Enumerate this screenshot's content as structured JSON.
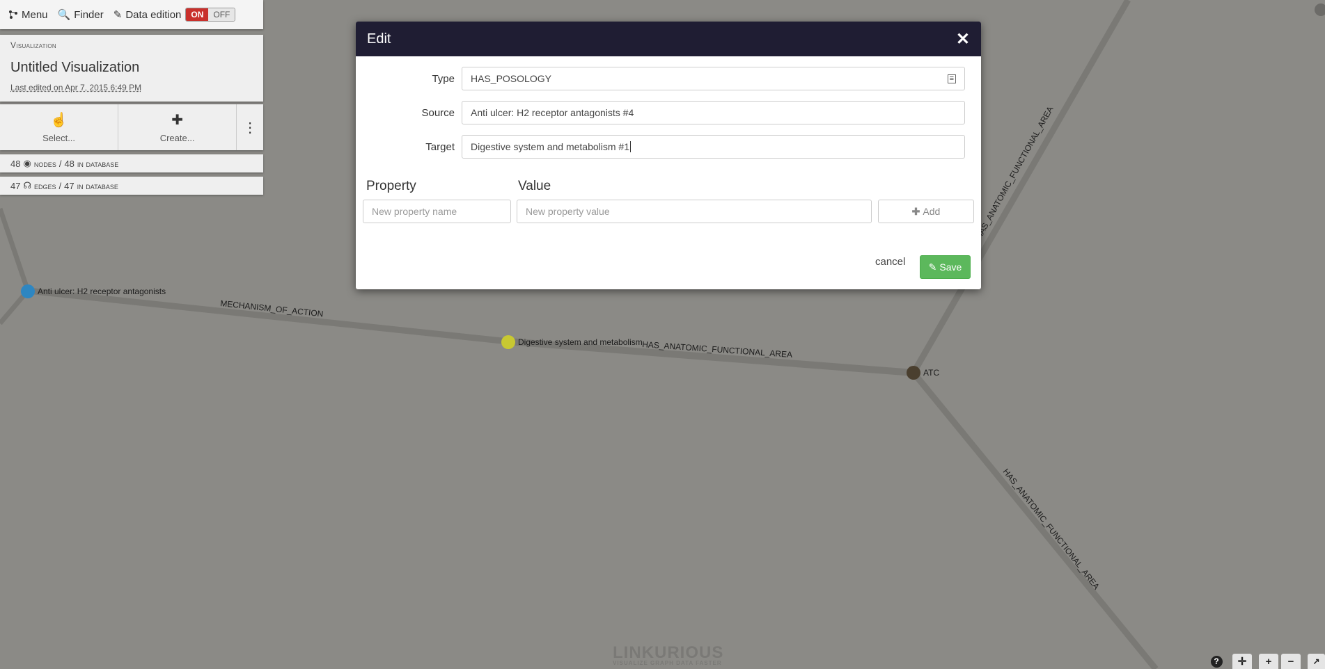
{
  "toolbar": {
    "menu_label": "Menu",
    "finder_label": "Finder",
    "data_edition_label": "Data edition",
    "toggle_on": "ON",
    "toggle_off": "OFF"
  },
  "visualization": {
    "kicker": "Visualization",
    "title": "Untitled Visualization",
    "last_edited": "Last edited on Apr 7, 2015 6:49 PM"
  },
  "actions": {
    "select_label": "Select...",
    "create_label": "Create..."
  },
  "counts": {
    "nodes_value": "48",
    "nodes_unit": "nodes",
    "nodes_sep": "/",
    "nodes_db_value": "48",
    "nodes_db_unit": "in database",
    "edges_value": "47",
    "edges_unit": "edges",
    "edges_sep": "/",
    "edges_db_value": "47",
    "edges_db_unit": "in database"
  },
  "modal": {
    "title": "Edit",
    "type_label": "Type",
    "type_value": "HAS_POSOLOGY",
    "source_label": "Source",
    "source_value": "Anti ulcer: H2 receptor antagonists #4",
    "target_label": "Target",
    "target_value": "Digestive system and metabolism #1",
    "property_heading": "Property",
    "value_heading": "Value",
    "property_placeholder": "New property name",
    "value_placeholder": "New property value",
    "add_label": "Add",
    "cancel_label": "cancel",
    "save_label": "Save"
  },
  "graph": {
    "nodes": [
      {
        "label": "Anti ulcer: H2 receptor antagonists",
        "color": "#2e86c1"
      },
      {
        "label": "Digestive system and metabolism",
        "color": "#c8c832"
      },
      {
        "label": "ATC",
        "color": "#4a3f2f"
      }
    ],
    "edges": [
      {
        "label": "MECHANISM_OF_ACTION"
      },
      {
        "label": "HAS_ANATOMIC_FUNCTIONAL_AREA"
      },
      {
        "label": "HAS_ANATOMIC_FUNCTIONAL_AREA"
      },
      {
        "label": "HAS_ANATOMIC_FUNCTIONAL_AREA"
      }
    ]
  },
  "watermark": {
    "brand": "LINKURIOUS",
    "tagline": "VISUALIZE GRAPH DATA FASTER"
  },
  "controls": {
    "help": "?",
    "center": "✛",
    "zoom_in": "+",
    "zoom_out": "−"
  }
}
